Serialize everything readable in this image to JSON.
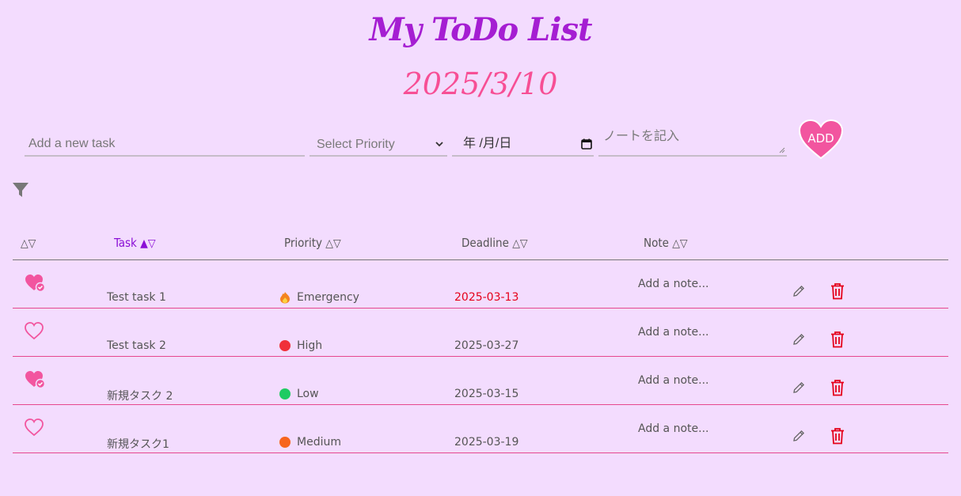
{
  "header": {
    "title": "My ToDo List",
    "date": "2025/3/10"
  },
  "form": {
    "task_placeholder": "Add a new task",
    "priority_selected": "Select Priority",
    "date_placeholder": "年 /月/日",
    "note_placeholder": "ノートを記入",
    "add_label": "ADD"
  },
  "table": {
    "columns": {
      "task": "Task",
      "priority": "Priority",
      "deadline": "Deadline",
      "note": "Note"
    },
    "rows": [
      {
        "favorite": true,
        "task": "Test task 1",
        "priority": "Emergency",
        "priority_icon": "fire-icon",
        "deadline": "2025-03-13",
        "urgent": true,
        "note": "Add a note..."
      },
      {
        "favorite": false,
        "task": "Test task 2",
        "priority": "High",
        "priority_color": "#f0303a",
        "deadline": "2025-03-27",
        "urgent": false,
        "note": "Add a note..."
      },
      {
        "favorite": true,
        "task": "新規タスク 2",
        "priority": "Low",
        "priority_color": "#1ecb62",
        "deadline": "2025-03-15",
        "urgent": false,
        "note": "Add a note..."
      },
      {
        "favorite": false,
        "task": "新規タスク1",
        "priority": "Medium",
        "priority_color": "#f7651e",
        "deadline": "2025-03-19",
        "urgent": false,
        "note": "Add a note..."
      }
    ]
  },
  "colors": {
    "background": "#f3dcfe",
    "title": "#a51ed2",
    "date": "#f74f95",
    "accent_pink": "#f2559f",
    "delete_red": "#e5001a",
    "sort_active": "#8b10d6"
  }
}
